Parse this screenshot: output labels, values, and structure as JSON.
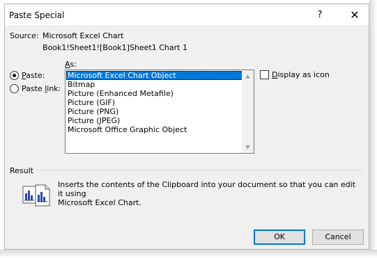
{
  "dialog": {
    "title": "Paste Special",
    "help_label": "?",
    "close_label": "✕"
  },
  "source": {
    "label": "Source:",
    "value": "Microsoft Excel Chart",
    "path": "Book1!Sheet1![Book1]Sheet1 Chart 1"
  },
  "paste_options": {
    "paste": {
      "label_first": "P",
      "label_rest": "aste:",
      "checked": true
    },
    "paste_link": {
      "label_prefix": "Paste ",
      "label_u": "l",
      "label_rest": "ink:",
      "checked": false
    }
  },
  "as": {
    "label_u": "A",
    "label_rest": "s:",
    "items": [
      "Microsoft Excel Chart Object",
      "Bitmap",
      "Picture (Enhanced Metafile)",
      "Picture (GIF)",
      "Picture (PNG)",
      "Picture (JPEG)",
      "Microsoft Office Graphic Object"
    ],
    "selected_index": 0
  },
  "display_as_icon": {
    "label_u": "D",
    "label_rest": "isplay as icon",
    "checked": false
  },
  "result": {
    "label": "Result",
    "text_line1": "Inserts the contents of the Clipboard into your document so that you can edit it using",
    "text_line2": "Microsoft Excel Chart.",
    "icon": "paste-chart-icon"
  },
  "buttons": {
    "ok": "OK",
    "cancel": "Cancel"
  },
  "colors": {
    "selection": "#0078d7",
    "dialog_bg": "#f0f0f0"
  }
}
